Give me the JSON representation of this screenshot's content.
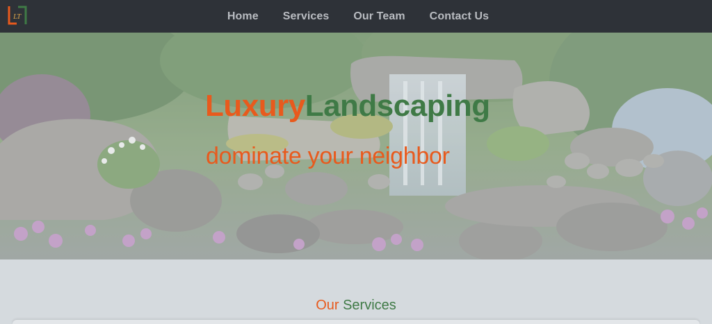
{
  "brand": {
    "logo_icon": "lt-monogram-icon",
    "colors": {
      "orange": "#e85a1d",
      "green": "#3f7a46",
      "nav_bg": "#2e3238"
    }
  },
  "nav": {
    "items": [
      {
        "label": "Home"
      },
      {
        "label": "Services"
      },
      {
        "label": "Our Team"
      },
      {
        "label": "Contact Us"
      }
    ]
  },
  "hero": {
    "title_part1": "Luxury",
    "title_part2": "Landscaping",
    "subtitle": "dominate your neighbor"
  },
  "services": {
    "title_part1": "Our",
    "title_part2": "Services"
  }
}
